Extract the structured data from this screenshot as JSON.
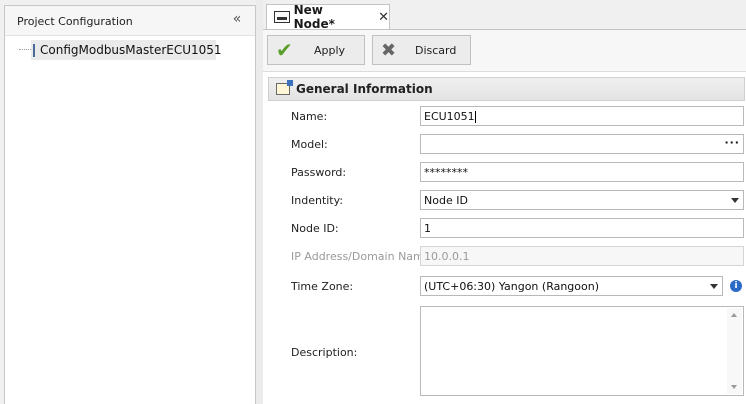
{
  "left_panel": {
    "title": "Project Configuration",
    "collapse_glyph": "«",
    "tree": [
      {
        "label": "ConfigModbusMasterECU1051",
        "icon": "window-icon"
      }
    ]
  },
  "tab": {
    "label": "New Node*",
    "close_glyph": "✕"
  },
  "toolbar": {
    "apply_label": "Apply",
    "discard_label": "Discard",
    "apply_glyph": "✔",
    "discard_glyph": "✖"
  },
  "section": {
    "title": "General Information",
    "icon": "properties-icon"
  },
  "form": {
    "name": {
      "label": "Name:",
      "value": "ECU1051"
    },
    "model": {
      "label": "Model:",
      "value": "",
      "button_glyph": "···"
    },
    "password": {
      "label": "Password:",
      "value": "********"
    },
    "identity": {
      "label": "Indentity:",
      "value": "Node ID"
    },
    "node_id": {
      "label": "Node ID:",
      "value": "1"
    },
    "ip_address": {
      "label": "IP Address/Domain Name:",
      "value": "10.0.0.1"
    },
    "time_zone": {
      "label": "Time Zone:",
      "value": "(UTC+06:30) Yangon (Rangoon)",
      "info_glyph": "i"
    },
    "description": {
      "label": "Description:",
      "value": ""
    }
  },
  "colors": {
    "accent_blue": "#2b6ac6",
    "apply_green": "#5a9e2a"
  }
}
